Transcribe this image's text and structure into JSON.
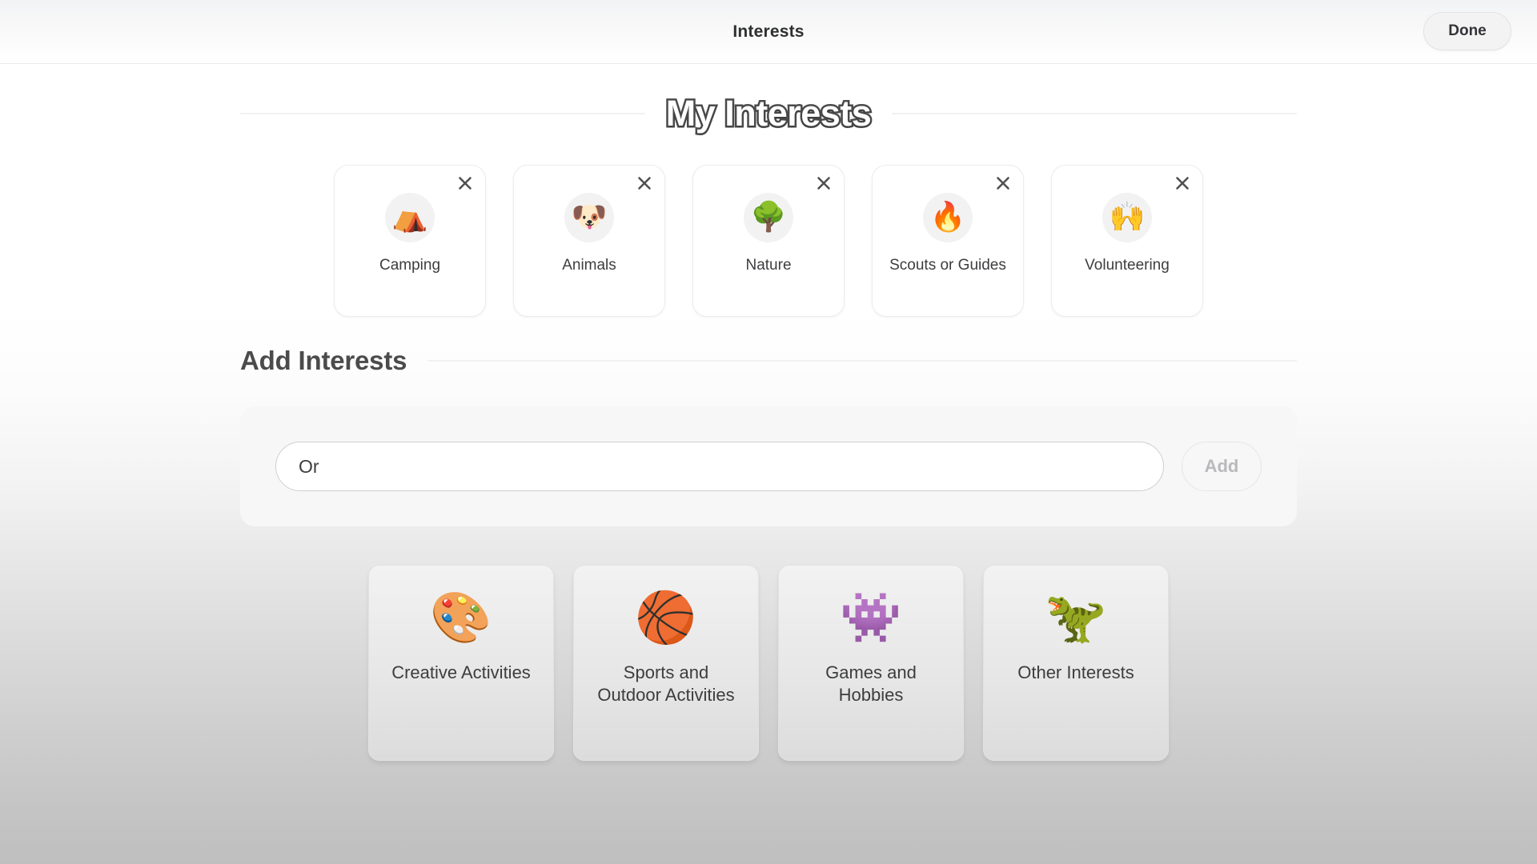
{
  "header": {
    "title": "Interests",
    "done_label": "Done"
  },
  "my_interests": {
    "title": "My Interests",
    "remove_icon": "close-icon",
    "items": [
      {
        "label": "Camping",
        "emoji": "⛺",
        "icon_name": "tent-emoji"
      },
      {
        "label": "Animals",
        "emoji": "🐶",
        "icon_name": "dog-face-emoji"
      },
      {
        "label": "Nature",
        "emoji": "🌳",
        "icon_name": "tree-emoji"
      },
      {
        "label": "Scouts or Guides",
        "emoji": "🔥",
        "icon_name": "campfire-emoji"
      },
      {
        "label": "Volunteering",
        "emoji": "🙌",
        "icon_name": "raised-hands-emoji"
      }
    ]
  },
  "add_interests": {
    "title": "Add Interests",
    "input_value": "Or",
    "input_placeholder": "",
    "add_label": "Add",
    "add_enabled": false
  },
  "categories": [
    {
      "label": "Creative Activities",
      "emoji": "🎨",
      "icon_name": "creative-box-icon"
    },
    {
      "label": "Sports and Outdoor Activities",
      "emoji": "🏀",
      "icon_name": "skateboard-basketball-icon"
    },
    {
      "label": "Games and Hobbies",
      "emoji": "👾",
      "icon_name": "joystick-puzzle-icon"
    },
    {
      "label": "Other Interests",
      "emoji": "🦖",
      "icon_name": "dinosaur-rosette-icon"
    }
  ],
  "colors": {
    "text_primary": "#3c3d3f",
    "heading": "#4b4b4b",
    "panel_bg": "#f7f7f8",
    "card_bg": "#ffffff",
    "category_bg": "#e7e7e7",
    "disabled_text": "#b9b9bc"
  }
}
